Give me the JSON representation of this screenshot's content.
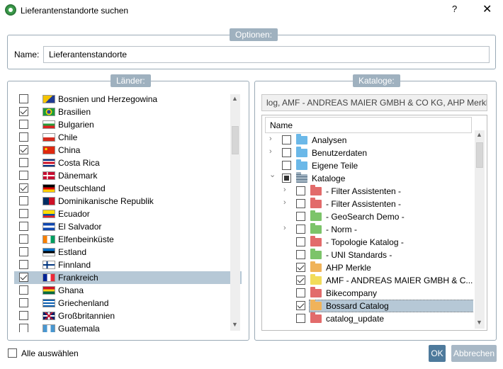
{
  "window": {
    "title": "Lieferantenstandorte suchen",
    "help_label": "?",
    "close_label": "✕"
  },
  "options": {
    "legend": "Optionen:",
    "name_label": "Name:",
    "name_value": "Lieferantenstandorte"
  },
  "countries": {
    "legend": "Länder:",
    "items": [
      {
        "label": "Bosnien und Herzegowina",
        "checked": false
      },
      {
        "label": "Brasilien",
        "checked": true
      },
      {
        "label": "Bulgarien",
        "checked": false
      },
      {
        "label": "Chile",
        "checked": false
      },
      {
        "label": "China",
        "checked": true
      },
      {
        "label": "Costa Rica",
        "checked": false
      },
      {
        "label": "Dänemark",
        "checked": false
      },
      {
        "label": "Deutschland",
        "checked": true
      },
      {
        "label": "Dominikanische Republik",
        "checked": false
      },
      {
        "label": "Ecuador",
        "checked": false
      },
      {
        "label": "El Salvador",
        "checked": false
      },
      {
        "label": "Elfenbeinküste",
        "checked": false
      },
      {
        "label": "Estland",
        "checked": false
      },
      {
        "label": "Finnland",
        "checked": false
      },
      {
        "label": "Frankreich",
        "checked": true,
        "selected": true
      },
      {
        "label": "Ghana",
        "checked": false
      },
      {
        "label": "Griechenland",
        "checked": false
      },
      {
        "label": "Großbritannien",
        "checked": false
      },
      {
        "label": "Guatemala",
        "checked": false
      }
    ]
  },
  "catalogs": {
    "legend": "Kataloge:",
    "path": "log, AMF - ANDREAS MAIER GMBH & CO KG, AHP Merkle",
    "column_header": "Name",
    "items": [
      {
        "label": "Analysen",
        "level": 0,
        "expander": "›",
        "check": "none",
        "folder": "#6bb8e8"
      },
      {
        "label": "Benutzerdaten",
        "level": 0,
        "expander": "›",
        "check": "none",
        "folder": "#6bb8e8"
      },
      {
        "label": "Eigene Teile",
        "level": 0,
        "expander": "",
        "check": "none",
        "folder": "#6bb8e8"
      },
      {
        "label": "Kataloge",
        "level": 0,
        "expander": "⌄",
        "check": "partial",
        "folder": "stack"
      },
      {
        "label": "- Filter Assistenten -",
        "level": 1,
        "expander": "›",
        "check": "none",
        "folder": "#e26b6b"
      },
      {
        "label": "- Filter Assistenten -",
        "level": 1,
        "expander": "›",
        "check": "none",
        "folder": "#e26b6b"
      },
      {
        "label": "- GeoSearch Demo -",
        "level": 1,
        "expander": "",
        "check": "none",
        "folder": "#7cc46a"
      },
      {
        "label": "- Norm -",
        "level": 1,
        "expander": "›",
        "check": "none",
        "folder": "#7cc46a"
      },
      {
        "label": "- Topologie Katalog -",
        "level": 1,
        "expander": "",
        "check": "none",
        "folder": "#e26b6b"
      },
      {
        "label": "- UNI Standards -",
        "level": 1,
        "expander": "",
        "check": "none",
        "folder": "#7cc46a"
      },
      {
        "label": "AHP Merkle",
        "level": 1,
        "expander": "",
        "check": "checked",
        "folder": "#f0b35a"
      },
      {
        "label": "AMF - ANDREAS MAIER GMBH & C...",
        "level": 1,
        "expander": "",
        "check": "checked",
        "folder": "#f2dc5a"
      },
      {
        "label": "Bikecompany",
        "level": 1,
        "expander": "",
        "check": "none",
        "folder": "#e26b6b"
      },
      {
        "label": "Bossard Catalog",
        "level": 1,
        "expander": "",
        "check": "checked",
        "folder": "#f0b35a",
        "selected": true
      },
      {
        "label": "catalog_update",
        "level": 1,
        "expander": "",
        "check": "none",
        "folder": "#e26b6b"
      }
    ]
  },
  "footer": {
    "select_all_label": "Alle auswählen",
    "ok_label": "OK",
    "cancel_label": "Abbrechen"
  }
}
